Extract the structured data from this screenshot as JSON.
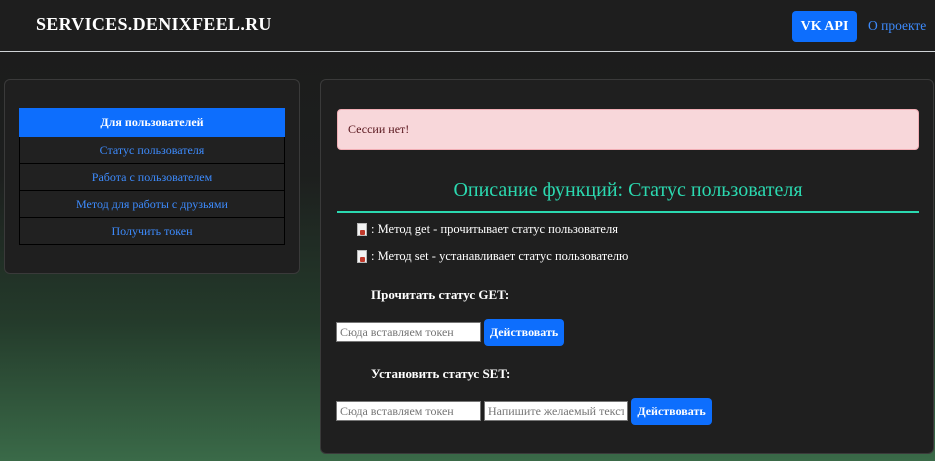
{
  "navbar": {
    "brand": "SERVICES.DENIXFEEL.RU",
    "vk_api_label": "VK API",
    "about_label": "О проекте"
  },
  "sidebar": {
    "items": [
      {
        "label": "Для пользователей",
        "active": true
      },
      {
        "label": "Статус пользователя",
        "active": false
      },
      {
        "label": "Работа с пользователем",
        "active": false
      },
      {
        "label": "Метод для работы с друзьями",
        "active": false
      },
      {
        "label": "Получить токен",
        "active": false
      }
    ]
  },
  "main": {
    "alert": "Сессии нет!",
    "title": "Описание функций: Статус пользователя",
    "methods": [
      {
        "icon": "document-icon",
        "text": ": Метод get - прочитывает статус пользователя"
      },
      {
        "icon": "document-icon",
        "text": ": Метод set - устанавливает статус пользователю"
      }
    ],
    "get_section": {
      "label": "Прочитать статус GET:",
      "token_placeholder": "Сюда вставляем токен",
      "button_label": "Действовать"
    },
    "set_section": {
      "label": "Установить статус SET:",
      "token_placeholder": "Сюда вставляем токен",
      "text_placeholder": "Напишите желаемый текст",
      "button_label": "Действовать"
    }
  },
  "colors": {
    "accent": "#0d6efd",
    "title": "#2bd9b0",
    "alert_bg": "#f8d7da"
  }
}
